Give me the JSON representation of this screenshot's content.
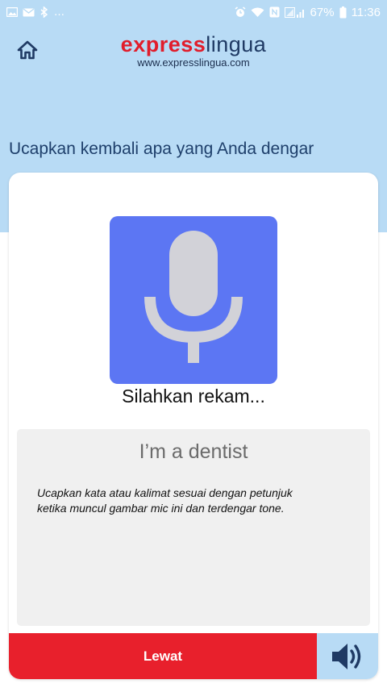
{
  "status_bar": {
    "left_glyph": "…",
    "battery": "67%",
    "time": "11:36",
    "icons": [
      "gallery-icon",
      "mail-icon",
      "bluetooth-icon",
      "alarm-icon",
      "wifi-icon",
      "nfc-icon",
      "signal-icon",
      "battery-icon"
    ]
  },
  "header": {
    "home_icon": "home-icon",
    "brand_express": "express",
    "brand_lingua": "lingua",
    "brand_url": "www.expresslingua.com"
  },
  "instruction": "Ucapkan kembali apa yang Anda dengar",
  "recorder": {
    "mic_icon": "microphone-icon",
    "status": "Silahkan rekam..."
  },
  "prompt": {
    "phrase": "I’m a dentist",
    "hint_line1": "Ucapkan kata atau kalimat sesuai dengan petunjuk",
    "hint_line2": "ketika muncul gambar mic ini dan terdengar tone."
  },
  "footer": {
    "skip_label": "Lewat",
    "speaker_icon": "speaker-icon"
  },
  "colors": {
    "header_bg": "#b8dbf5",
    "mic_bg": "#5c76f3",
    "skip_bg": "#e8202c",
    "brand_red": "#e11d2b",
    "brand_navy": "#1f3a64"
  }
}
